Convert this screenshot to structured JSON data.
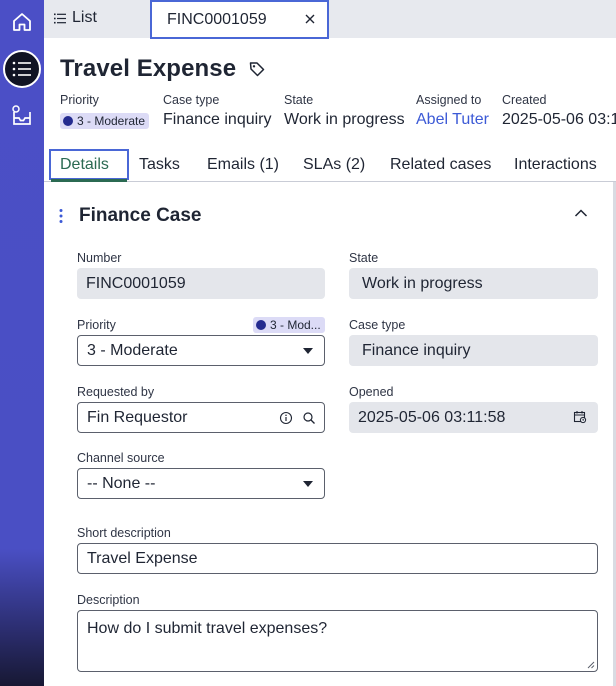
{
  "tabs": {
    "list_label": "List",
    "active_label": "FINC0001059"
  },
  "record": {
    "title": "Travel Expense"
  },
  "meta": {
    "priority_label": "Priority",
    "priority_value": "3 - Moderate",
    "case_type_label": "Case type",
    "case_type_value": "Finance inquiry",
    "state_label": "State",
    "state_value": "Work in progress",
    "assigned_label": "Assigned to",
    "assigned_value": "Abel Tuter",
    "created_label": "Created",
    "created_value": "2025-05-06 03:1"
  },
  "subtabs": [
    {
      "label": "Details"
    },
    {
      "label": "Tasks"
    },
    {
      "label": "Emails (1)"
    },
    {
      "label": "SLAs (2)"
    },
    {
      "label": "Related cases"
    },
    {
      "label": "Interactions"
    }
  ],
  "section": {
    "title": "Finance Case"
  },
  "form": {
    "number_label": "Number",
    "number_value": "FINC0001059",
    "state_label": "State",
    "state_value": "Work in progress",
    "priority_label": "Priority",
    "priority_badge": "3 - Mod...",
    "priority_value": "3 - Moderate",
    "case_type_label": "Case type",
    "case_type_value": "Finance inquiry",
    "requested_by_label": "Requested by",
    "requested_by_value": "Fin Requestor",
    "opened_label": "Opened",
    "opened_value": "2025-05-06 03:11:58",
    "channel_label": "Channel source",
    "channel_value": "-- None --",
    "short_desc_label": "Short description",
    "short_desc_value": "Travel Expense",
    "description_label": "Description",
    "description_value": "How do I submit travel expenses?"
  },
  "icons": {
    "home": "home-icon",
    "list": "list-icon",
    "inbox": "inbox-icon",
    "tag": "tag-icon",
    "close": "close-icon",
    "info": "info-icon",
    "search": "search-icon",
    "calendar": "calendar-icon"
  },
  "colors": {
    "rail": "#4b4fc6",
    "accent": "#4a67d6",
    "link": "#3c5ad6",
    "active_tab": "#2b6a52",
    "priority_dot": "#242b8f"
  }
}
